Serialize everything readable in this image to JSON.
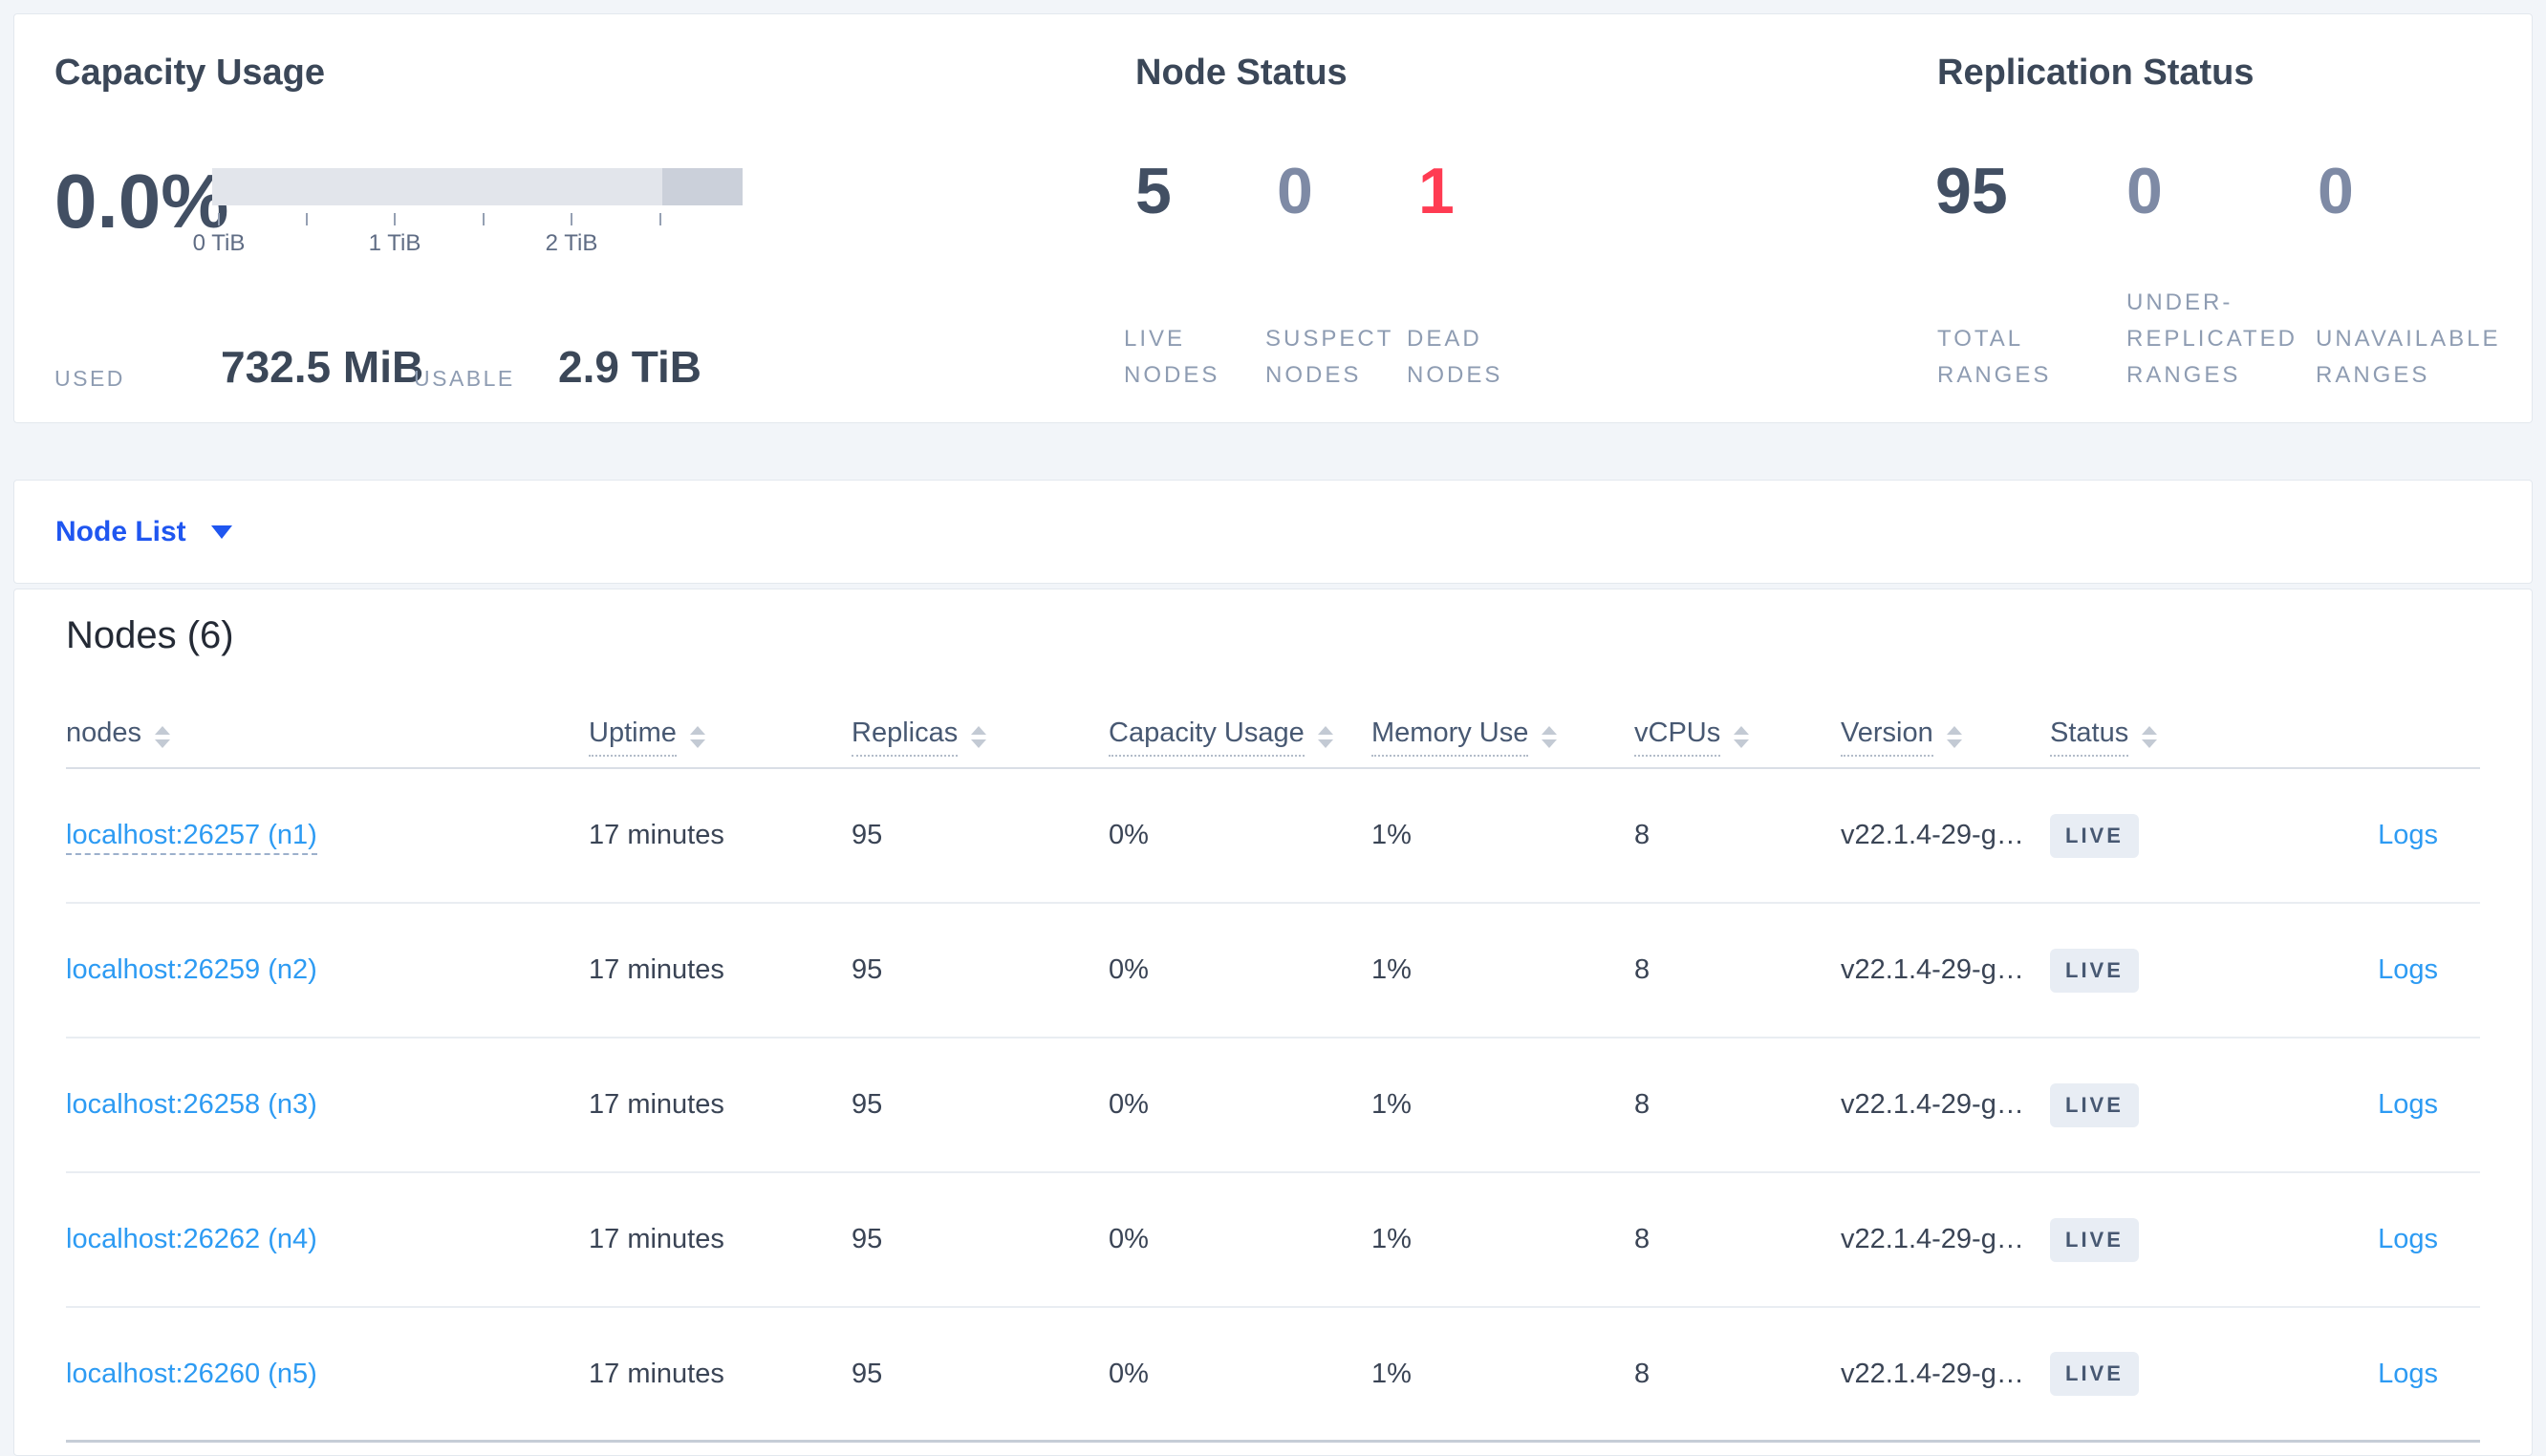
{
  "overview": {
    "capacity": {
      "title": "Capacity Usage",
      "percent": "0.0%",
      "tick_labels": [
        {
          "text": "0 TiB"
        },
        {
          "text": "1 TiB"
        },
        {
          "text": "2 TiB"
        }
      ],
      "used_label": "USED",
      "used_value": "732.5 MiB",
      "usable_label": "USABLE",
      "usable_value": "2.9 TiB"
    },
    "node_status": {
      "title": "Node Status",
      "stats": [
        {
          "value": "5",
          "label": "LIVE NODES",
          "tone": "dark"
        },
        {
          "value": "0",
          "label": "SUSPECT NODES",
          "tone": "muted"
        },
        {
          "value": "1",
          "label": "DEAD NODES",
          "tone": "danger"
        }
      ]
    },
    "replication_status": {
      "title": "Replication Status",
      "stats": [
        {
          "value": "95",
          "label": "TOTAL RANGES",
          "tone": "dark"
        },
        {
          "value": "0",
          "label": "UNDER-REPLICATED RANGES",
          "tone": "muted"
        },
        {
          "value": "0",
          "label": "UNAVAILABLE RANGES",
          "tone": "muted"
        }
      ]
    }
  },
  "view_selector": {
    "label": "Node List"
  },
  "nodes_section": {
    "title": "Nodes (6)",
    "logs_label": "Logs",
    "columns": [
      {
        "key": "node",
        "label": "nodes",
        "underline": "plain"
      },
      {
        "key": "uptime",
        "label": "Uptime",
        "underline": "dotted"
      },
      {
        "key": "replicas",
        "label": "Replicas",
        "underline": "dotted"
      },
      {
        "key": "capacity",
        "label": "Capacity Usage",
        "underline": "dotted"
      },
      {
        "key": "memory",
        "label": "Memory Use",
        "underline": "dotted"
      },
      {
        "key": "vcpus",
        "label": "vCPUs",
        "underline": "dotted"
      },
      {
        "key": "version",
        "label": "Version",
        "underline": "dotted"
      },
      {
        "key": "status",
        "label": "Status",
        "underline": "dotted"
      }
    ],
    "rows": [
      {
        "node": "localhost:26257 (n1)",
        "uptime": "17 minutes",
        "replicas": "95",
        "capacity": "0%",
        "memory": "1%",
        "vcpus": "8",
        "version": "v22.1.4-29-g…",
        "status": "LIVE",
        "link_state": "hovered"
      },
      {
        "node": "localhost:26259 (n2)",
        "uptime": "17 minutes",
        "replicas": "95",
        "capacity": "0%",
        "memory": "1%",
        "vcpus": "8",
        "version": "v22.1.4-29-g…",
        "status": "LIVE"
      },
      {
        "node": "localhost:26258 (n3)",
        "uptime": "17 minutes",
        "replicas": "95",
        "capacity": "0%",
        "memory": "1%",
        "vcpus": "8",
        "version": "v22.1.4-29-g…",
        "status": "LIVE"
      },
      {
        "node": "localhost:26262 (n4)",
        "uptime": "17 minutes",
        "replicas": "95",
        "capacity": "0%",
        "memory": "1%",
        "vcpus": "8",
        "version": "v22.1.4-29-g…",
        "status": "LIVE"
      },
      {
        "node": "localhost:26260 (n5)",
        "uptime": "17 minutes",
        "replicas": "95",
        "capacity": "0%",
        "memory": "1%",
        "vcpus": "8",
        "version": "v22.1.4-29-g…",
        "status": "LIVE"
      }
    ]
  },
  "colors": {
    "page_background": "#f2f5f9",
    "selector_blue": "#1f56f0",
    "link_blue": "#2d9bf3",
    "danger_red": "#ff3b52",
    "dark_slate": "#424f63",
    "muted_slate": "#7e8aa5",
    "label_slate": "#8e9cb2",
    "badge_background": "#e8edf4",
    "bar_usable": "#e2e5eb",
    "bar_other": "#cbd0da"
  }
}
